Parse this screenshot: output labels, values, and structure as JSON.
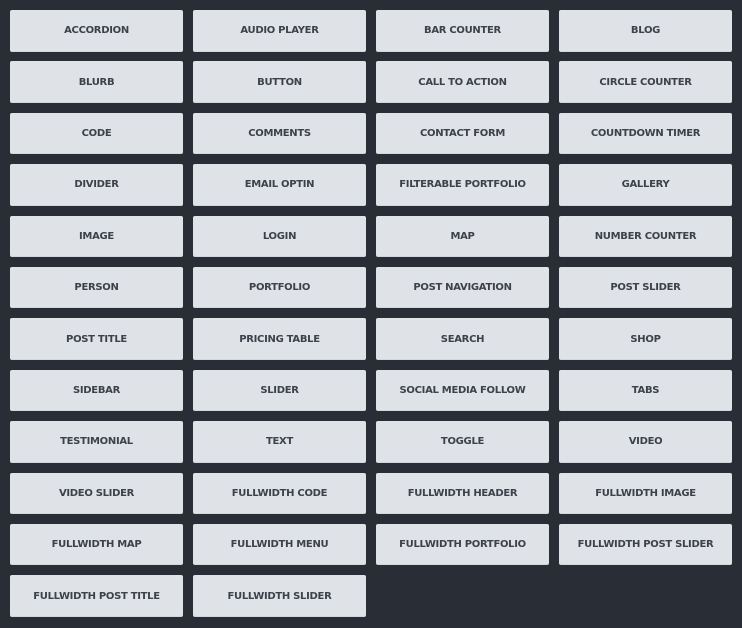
{
  "colors": {
    "background": "#282d36",
    "button": "#dfe3e7",
    "button_text": "#3d424a"
  },
  "modules": [
    "ACCORDION",
    "AUDIO PLAYER",
    "BAR COUNTER",
    "BLOG",
    "BLURB",
    "BUTTON",
    "CALL TO ACTION",
    "CIRCLE COUNTER",
    "CODE",
    "COMMENTS",
    "CONTACT FORM",
    "COUNTDOWN TIMER",
    "DIVIDER",
    "EMAIL OPTIN",
    "FILTERABLE PORTFOLIO",
    "GALLERY",
    "IMAGE",
    "LOGIN",
    "MAP",
    "NUMBER COUNTER",
    "PERSON",
    "PORTFOLIO",
    "POST NAVIGATION",
    "POST SLIDER",
    "POST TITLE",
    "PRICING TABLE",
    "SEARCH",
    "SHOP",
    "SIDEBAR",
    "SLIDER",
    "SOCIAL MEDIA FOLLOW",
    "TABS",
    "TESTIMONIAL",
    "TEXT",
    "TOGGLE",
    "VIDEO",
    "VIDEO SLIDER",
    "FULLWIDTH CODE",
    "FULLWIDTH HEADER",
    "FULLWIDTH IMAGE",
    "FULLWIDTH MAP",
    "FULLWIDTH MENU",
    "FULLWIDTH PORTFOLIO",
    "FULLWIDTH POST SLIDER",
    "FULLWIDTH POST TITLE",
    "FULLWIDTH SLIDER"
  ]
}
